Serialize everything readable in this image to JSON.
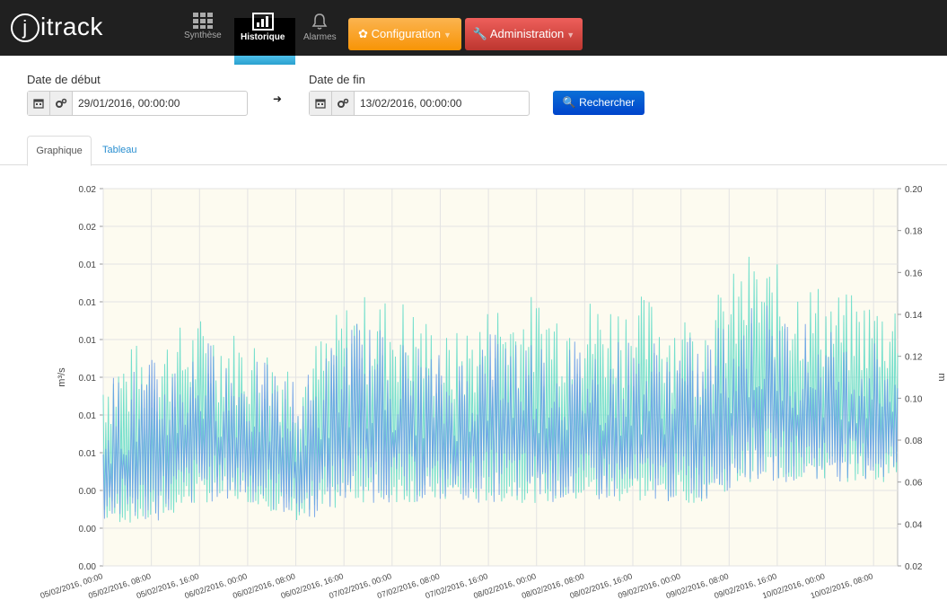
{
  "app": {
    "logo": "jitrack"
  },
  "nav": {
    "synthese": "Synthèse",
    "historique": "Historique",
    "alarmes": "Alarmes",
    "configuration": "Configuration",
    "administration": "Administration"
  },
  "filters": {
    "start_label": "Date de début",
    "start_value": "29/01/2016, 00:00:00",
    "end_label": "Date de fin",
    "end_value": "13/02/2016, 00:00:00",
    "search_label": "Rechercher"
  },
  "tabs": {
    "graph": "Graphique",
    "table": "Tableau"
  },
  "colors": {
    "series_flow": "#6a9ee8",
    "series_level": "#64dcc8",
    "plot_bg": "#fdfbf0",
    "accent": "#2aa0cf"
  },
  "chart_data": {
    "type": "line",
    "y_left": {
      "label": "m³/s",
      "ticks": [
        "0.00",
        "0.00",
        "0.00",
        "0.01",
        "0.01",
        "0.01",
        "0.01",
        "0.01",
        "0.01",
        "0.02",
        "0.02"
      ]
    },
    "y_right": {
      "label": "m",
      "ticks": [
        "0.02",
        "0.04",
        "0.06",
        "0.08",
        "0.10",
        "0.12",
        "0.14",
        "0.16",
        "0.18",
        "0.20"
      ],
      "ylim": [
        0.02,
        0.2
      ]
    },
    "x_ticks": [
      "05/02/2016, 00:00",
      "05/02/2016, 08:00",
      "05/02/2016, 16:00",
      "06/02/2016, 00:00",
      "06/02/2016, 08:00",
      "06/02/2016, 16:00",
      "07/02/2016, 00:00",
      "07/02/2016, 08:00",
      "07/02/2016, 16:00",
      "08/02/2016, 00:00",
      "08/02/2016, 08:00",
      "08/02/2016, 16:00",
      "09/02/2016, 00:00",
      "09/02/2016, 08:00",
      "09/02/2016, 16:00",
      "10/02/2016, 00:00",
      "10/02/2016, 08:00"
    ],
    "grid": true,
    "note_series": "dense oscillating series, values read approximately",
    "series": [
      {
        "color": "#64dcc8",
        "pattern": "peaks",
        "envelope_low": [
          0.04,
          0.04,
          0.05,
          0.05,
          0.04,
          0.05,
          0.05,
          0.05,
          0.05,
          0.05,
          0.05,
          0.05,
          0.05,
          0.06,
          0.06,
          0.06,
          0.06
        ],
        "envelope_high": [
          0.12,
          0.13,
          0.14,
          0.13,
          0.12,
          0.15,
          0.15,
          0.13,
          0.15,
          0.15,
          0.15,
          0.15,
          0.14,
          0.17,
          0.16,
          0.15,
          0.15
        ]
      },
      {
        "color": "#6a9ee8",
        "pattern": "dense",
        "envelope_low": [
          0.04,
          0.04,
          0.05,
          0.05,
          0.04,
          0.05,
          0.05,
          0.05,
          0.05,
          0.05,
          0.05,
          0.05,
          0.05,
          0.06,
          0.06,
          0.06,
          0.06
        ],
        "envelope_high": [
          0.11,
          0.12,
          0.13,
          0.12,
          0.11,
          0.14,
          0.13,
          0.12,
          0.14,
          0.13,
          0.13,
          0.13,
          0.13,
          0.15,
          0.14,
          0.13,
          0.13
        ]
      }
    ]
  }
}
